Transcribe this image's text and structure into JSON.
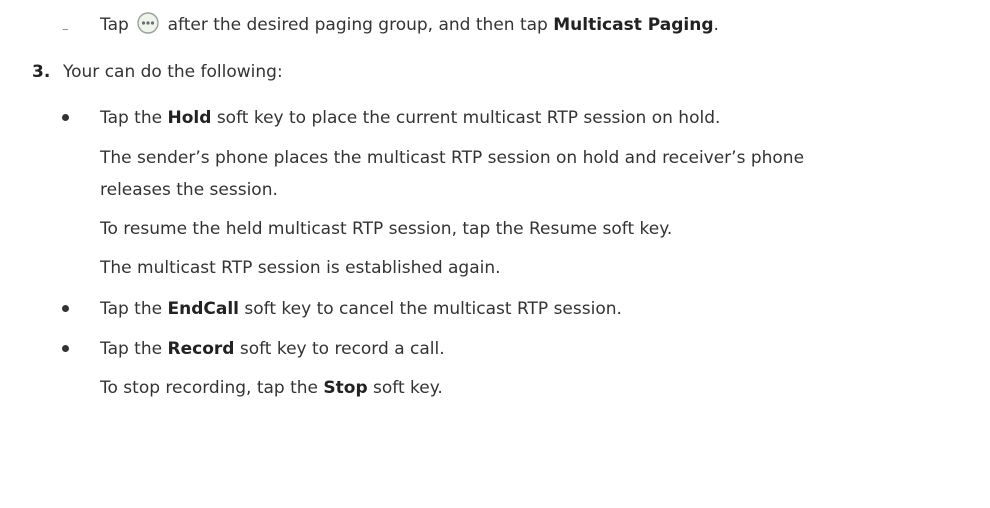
{
  "items": {
    "tap_more": {
      "prefix": "Tap",
      "icon": "more-options-icon",
      "middle": "after the desired paging group, and then tap",
      "bold": "Multicast Paging",
      "suffix": "."
    },
    "step3": {
      "number": "3.",
      "text": "Your can do the following:"
    },
    "hold": {
      "prefix": "Tap the",
      "bold": "Hold",
      "suffix": "soft key to place the current multicast RTP session on hold."
    },
    "hold_desc1_line1": "The sender’s phone places the multicast RTP session on hold and receiver’s phone",
    "hold_desc1_line2": "releases the session.",
    "hold_desc2": "To resume the held multicast RTP session, tap the Resume soft key.",
    "hold_desc3": "The multicast RTP session is established again.",
    "endcall": {
      "prefix": "Tap the",
      "bold": "EndCall",
      "suffix": "soft key to cancel the multicast RTP session."
    },
    "record": {
      "prefix": "Tap the",
      "bold": "Record",
      "suffix": "soft key to record a call."
    },
    "stop": {
      "prefix": "To stop recording, tap the",
      "bold": "Stop",
      "suffix": "soft key."
    }
  }
}
